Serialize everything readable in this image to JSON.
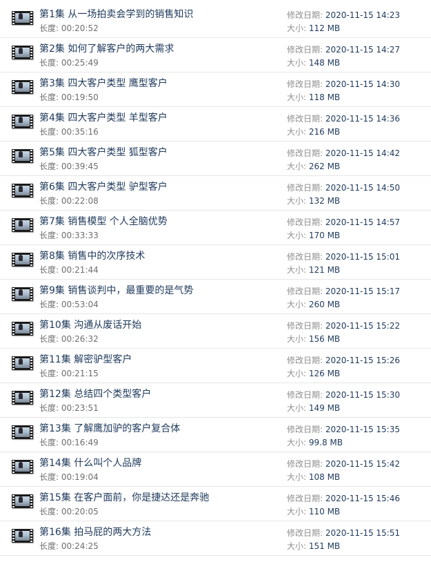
{
  "labels": {
    "duration": "长度: ",
    "modified": "修改日期: ",
    "size": "大小: "
  },
  "files": [
    {
      "title": "第1集 从一场拍卖会学到的销售知识",
      "duration": "00:20:52",
      "modified": "2020-11-15 14:23",
      "size": "112 MB"
    },
    {
      "title": "第2集 如何了解客户的两大需求",
      "duration": "00:25:49",
      "modified": "2020-11-15 14:27",
      "size": "148 MB"
    },
    {
      "title": "第3集 四大客户类型 鹰型客户",
      "duration": "00:19:50",
      "modified": "2020-11-15 14:30",
      "size": "118 MB"
    },
    {
      "title": "第4集 四大客户类型 羊型客户",
      "duration": "00:35:16",
      "modified": "2020-11-15 14:36",
      "size": "216 MB"
    },
    {
      "title": "第5集 四大客户类型 狐型客户",
      "duration": "00:39:45",
      "modified": "2020-11-15 14:42",
      "size": "262 MB"
    },
    {
      "title": "第6集 四大客户类型 驴型客户",
      "duration": "00:22:08",
      "modified": "2020-11-15 14:50",
      "size": "132 MB"
    },
    {
      "title": "第7集 销售模型 个人全脑优势",
      "duration": "00:33:33",
      "modified": "2020-11-15 14:57",
      "size": "170 MB"
    },
    {
      "title": "第8集 销售中的次序技术",
      "duration": "00:21:44",
      "modified": "2020-11-15 15:01",
      "size": "121 MB"
    },
    {
      "title": "第9集 销售谈判中，最重要的是气势",
      "duration": "00:53:04",
      "modified": "2020-11-15 15:17",
      "size": "260 MB"
    },
    {
      "title": "第10集 沟通从废话开始",
      "duration": "00:26:32",
      "modified": "2020-11-15 15:22",
      "size": "156 MB"
    },
    {
      "title": "第11集 解密驴型客户",
      "duration": "00:21:15",
      "modified": "2020-11-15 15:26",
      "size": "126 MB"
    },
    {
      "title": "第12集 总结四个类型客户",
      "duration": "00:23:51",
      "modified": "2020-11-15 15:30",
      "size": "149 MB"
    },
    {
      "title": "第13集 了解鹰加驴的客户复合体",
      "duration": "00:16:49",
      "modified": "2020-11-15 15:35",
      "size": "99.8 MB"
    },
    {
      "title": "第14集 什么叫个人品牌",
      "duration": "00:19:04",
      "modified": "2020-11-15 15:42",
      "size": "108 MB"
    },
    {
      "title": "第15集 在客户面前，你是捷达还是奔驰",
      "duration": "00:20:05",
      "modified": "2020-11-15 15:46",
      "size": "110 MB"
    },
    {
      "title": "第16集 拍马屁的两大方法",
      "duration": "00:24:25",
      "modified": "2020-11-15 15:51",
      "size": "151 MB"
    }
  ],
  "icon": "video-file-icon",
  "colors": {
    "title": "#1e395b",
    "label": "#8e8e8e",
    "separator": "#e6e6e6"
  }
}
